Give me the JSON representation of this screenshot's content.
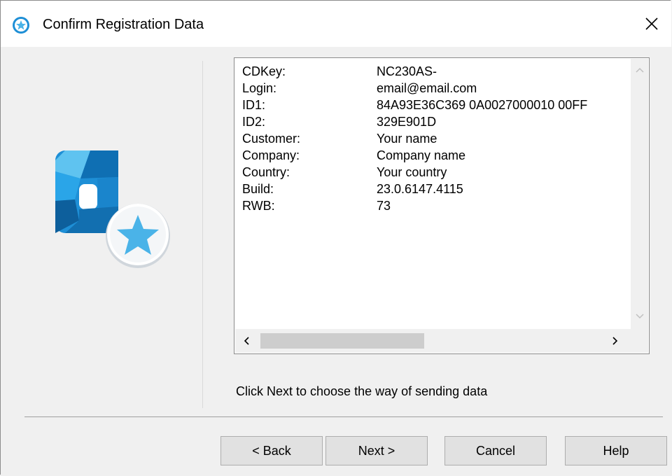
{
  "window": {
    "title": "Confirm Registration Data",
    "close_glyph": "✕"
  },
  "registration": {
    "rows": [
      {
        "label": "CDKey:",
        "value": "NC230AS-"
      },
      {
        "label": "Login:",
        "value": "email@email.com"
      },
      {
        "label": "ID1:",
        "value": "84A93E36C369 0A0027000010 00FF"
      },
      {
        "label": "ID2:",
        "value": "329E901D"
      },
      {
        "label": "Customer:",
        "value": "Your name"
      },
      {
        "label": "Company:",
        "value": "Company name"
      },
      {
        "label": "Country:",
        "value": "Your country"
      },
      {
        "label": "Build:",
        "value": "23.0.6147.4115"
      },
      {
        "label": "RWB:",
        "value": "73"
      }
    ],
    "scroll": {
      "up_glyph": "⌃",
      "down_glyph": "⌄",
      "left_glyph": "‹",
      "right_glyph": "›"
    }
  },
  "hint": "Click Next to choose the way of sending data",
  "buttons": {
    "back": "< Back",
    "next": "Next >",
    "cancel": "Cancel",
    "help": "Help"
  },
  "colors": {
    "accent_blue": "#1e8fd6",
    "star_blue": "#4ab3e8"
  },
  "icons": {
    "title": "registration-star-icon",
    "logo": "app-logo-star-icon"
  }
}
